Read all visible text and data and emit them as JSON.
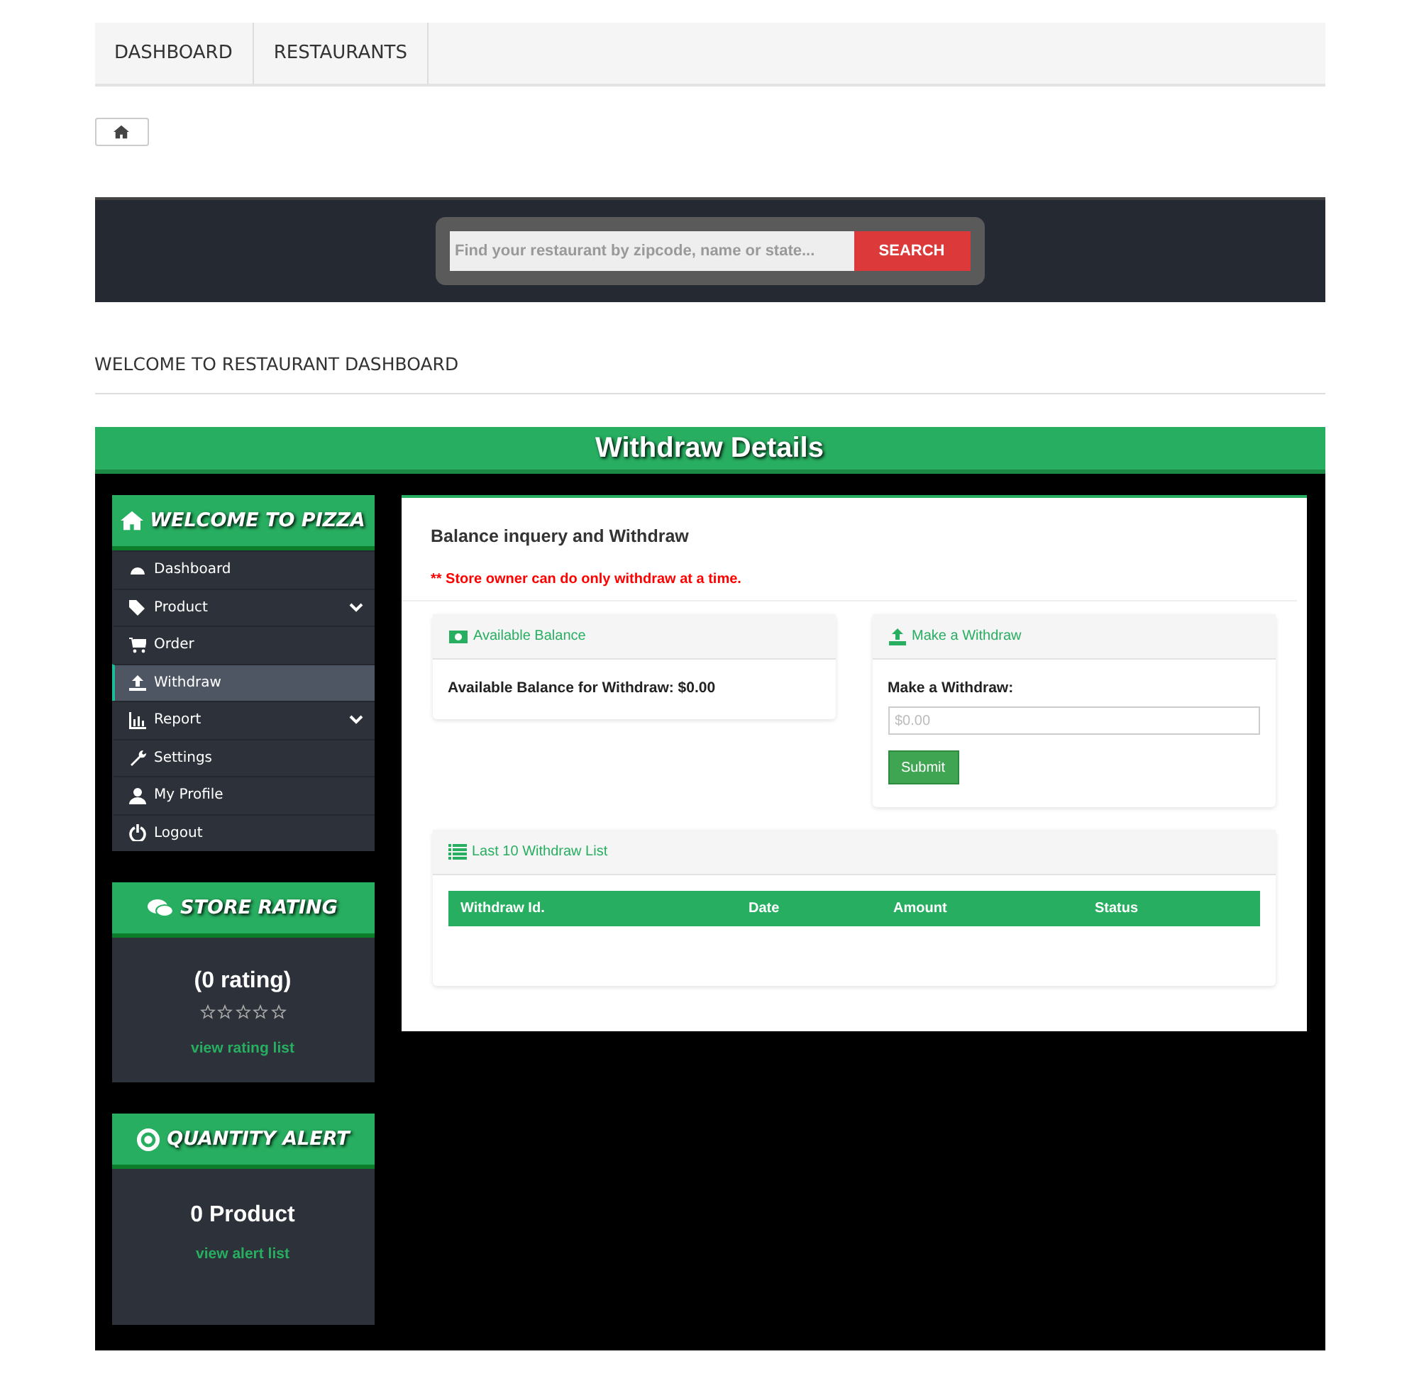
{
  "nav": {
    "tabs": [
      {
        "label": "DASHBOARD"
      },
      {
        "label": "RESTAURANTS"
      }
    ]
  },
  "search": {
    "placeholder": "Find your restaurant by zipcode, name or state...",
    "button": "SEARCH"
  },
  "page_heading": "WELCOME TO RESTAURANT DASHBOARD",
  "banner_title": "Withdraw Details",
  "sidebar": {
    "title": "WELCOME TO PIZZA",
    "items": [
      {
        "label": "Dashboard",
        "selected": false,
        "expandable": false
      },
      {
        "label": "Product",
        "selected": false,
        "expandable": true
      },
      {
        "label": "Order",
        "selected": false,
        "expandable": false
      },
      {
        "label": "Withdraw",
        "selected": true,
        "expandable": false
      },
      {
        "label": "Report",
        "selected": false,
        "expandable": true
      },
      {
        "label": "Settings",
        "selected": false,
        "expandable": false
      },
      {
        "label": "My Profile",
        "selected": false,
        "expandable": false
      },
      {
        "label": "Logout",
        "selected": false,
        "expandable": false
      }
    ]
  },
  "store_rating": {
    "title": "STORE RATING",
    "count": "(0 rating)",
    "stars": 0,
    "link": "view rating list"
  },
  "quantity_alert": {
    "title": "QUANTITY ALERT",
    "count": "0 Product",
    "link": "view alert list"
  },
  "panel": {
    "title": "Balance inquery and Withdraw",
    "notice": "** Store owner can do only withdraw at a time.",
    "balance_card": {
      "title": "Available Balance",
      "text": "Available Balance for Withdraw: $0.00"
    },
    "withdraw_card": {
      "title": "Make a Withdraw",
      "label": "Make a Withdraw:",
      "placeholder": "$0.00",
      "button": "Submit"
    },
    "list_card": {
      "title": "Last 10 Withdraw List",
      "columns": [
        "Withdraw Id.",
        "Date",
        "Amount",
        "Status"
      ]
    }
  }
}
